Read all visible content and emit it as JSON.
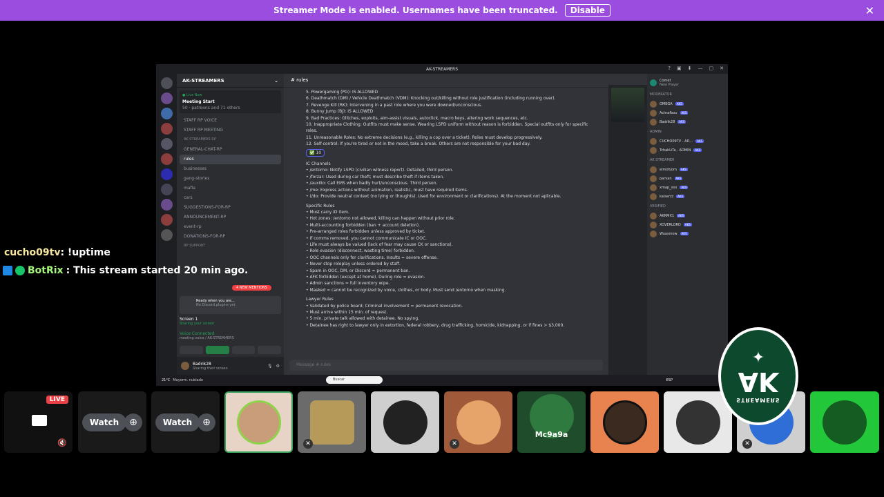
{
  "banner": {
    "text": "Streamer Mode is enabled. Usernames have been truncated.",
    "disable_label": "Disable",
    "close": "✕"
  },
  "window": {
    "title": "AK-STREAMERS",
    "controls": [
      "?",
      "▣",
      "⬇",
      "—",
      "▢",
      "✕"
    ]
  },
  "server": {
    "name": "AK-STREAMERS",
    "event_status": "● Live Now",
    "event_title": "Meeting Start",
    "event_meta": "50 · patreons and 71 others"
  },
  "channels": [
    {
      "label": "STAFF RP VOICE"
    },
    {
      "label": "STAFF RP MEETING"
    },
    {
      "label": "AK STREAMERS RP",
      "cat": true
    },
    {
      "label": "GENERAL-CHAT-RP"
    },
    {
      "label": "rules",
      "selected": true
    },
    {
      "label": "businesses"
    },
    {
      "label": "gang-stories"
    },
    {
      "label": "mafia"
    },
    {
      "label": "cars"
    },
    {
      "label": "SUGGESTIONS-FOR-RP"
    },
    {
      "label": "ANNOUNCEMENT-RP"
    },
    {
      "label": "event-rp"
    },
    {
      "label": "DONATIONS-FOR-RP"
    },
    {
      "label": "RP support",
      "cat": true
    }
  ],
  "mention_badge": "4 NEW MENTIONS",
  "popup": {
    "title": "Ready when you are...",
    "sub": "No Discord plugins yet"
  },
  "screen": {
    "label": "Screen 1",
    "sub": "Sharing your screen"
  },
  "voice": {
    "status": "Voice Connected",
    "channel": "meeting voice / AK-STREAMERS"
  },
  "user": {
    "name": "Badrik28",
    "status": "Sharing their screen"
  },
  "main": {
    "header": "rules",
    "lines": [
      {
        "t": "5. Powergaming (PG): IS ALLOWED"
      },
      {
        "t": "6. Deathmatch (DM) / Vehicle Deathmatch (VDM): Knocking out/killing without role justification (including running over)."
      },
      {
        "t": "7. Revenge Kill (RK): Intervening in a past role where you were downed/unconscious."
      },
      {
        "t": "8. Bunny Jump (BJ): IS ALLOWED"
      },
      {
        "t": "9. Bad Practices: Glitches, exploits, aim-assist visuals, autoclick, macro keys, altering work sequences, etc."
      },
      {
        "t": "10. Inappropriate Clothing: Outfits must make sense. Wearing LSPD uniform without reason is forbidden. Special outfits only for specific roles."
      },
      {
        "t": "11. Unreasonable Roles: No extreme decisions (e.g., killing a cop over a ticket). Roles must develop progressively."
      },
      {
        "t": "12. Self-control: If you're tired or not in the mood, take a break. Others are not responsible for your bad day."
      },
      {
        "t": "IC Channels",
        "h": true
      },
      {
        "t": "• /entorno: Notify LSPD (civilian witness report). Detailed, third person."
      },
      {
        "t": "• /forzar: Used during car theft; must describe theft if items taken."
      },
      {
        "t": "• /auxilio: Call EMS when badly hurt/unconscious. Third person."
      },
      {
        "t": "• /me: Express actions without animation, realistic, must have required items."
      },
      {
        "t": "• (/do: Provide neutral context (no lying or thoughts). Used for environment or clarifications). At the moment not aplicable."
      },
      {
        "t": "Specific Rules",
        "h": true
      },
      {
        "t": "• Must carry ID item."
      },
      {
        "t": "• Hot zones: /entorno not allowed, killing can happen without prior role."
      },
      {
        "t": "• Multi-accounting forbidden (ban + account deletion)."
      },
      {
        "t": "• Pre-arranged roles forbidden unless approved by ticket."
      },
      {
        "t": "• If comms removed, you cannot communicate IC or OOC."
      },
      {
        "t": "• Life must always be valued (lack of fear may cause CK or sanctions)."
      },
      {
        "t": "• Role evasion (disconnect, wasting time) forbidden."
      },
      {
        "t": "• OOC channels only for clarifications. Insults = severe offense."
      },
      {
        "t": "• Never stop roleplay unless ordered by staff."
      },
      {
        "t": "• Spam in OOC, DM, or Discord = permanent ban."
      },
      {
        "t": "• AFK forbidden (except at home). During role = evasion."
      },
      {
        "t": "• Admin sanctions = full inventory wipe."
      },
      {
        "t": "• Masked = cannot be recognized by voice, clothes, or body. Must send /entorno when masking."
      },
      {
        "t": "Lawyer Rules",
        "h": true
      },
      {
        "t": "• Validated by police board. Criminal involvement = permanent revocation."
      },
      {
        "t": "• Must arrive within 15 min. of request."
      },
      {
        "t": "• 5 min. private talk allowed with detainee. No spying."
      },
      {
        "t": "• Detainee has right to lawyer only in extortion, federal robbery, drug trafficking, homicide, kidnapping, or if fines > $3,000."
      }
    ],
    "reaction": "✅ 10",
    "input_placeholder": "Message # rules"
  },
  "members": {
    "top_name": "Comet",
    "top_sub": "New Player",
    "cat1": "MODERATOR",
    "list1": [
      {
        "n": "OMEGA",
        "tag": "AKS"
      },
      {
        "n": "Achrafbou",
        "tag": "AKS"
      },
      {
        "n": "Badrik28",
        "tag": "AKS"
      }
    ],
    "cat2": "ADMIN",
    "list2": [
      {
        "n": "CUCHO09TV - AD...",
        "tag": "AKS"
      },
      {
        "n": "TchakLiTa - ADMIN",
        "tag": "AKS"
      }
    ],
    "cat3": "AK STREAMER",
    "list3": [
      {
        "n": "elmohjom",
        "tag": "AKS"
      },
      {
        "n": "parvan",
        "tag": "AKS"
      },
      {
        "n": "xmap_xxx",
        "tag": "AKS"
      },
      {
        "n": "kaiserzz",
        "tag": "AKS"
      }
    ],
    "cat4": "VERIFIED",
    "list4": [
      {
        "n": "AKRMX1",
        "tag": "AKS"
      },
      {
        "n": "XOVERLORD",
        "tag": "AKS"
      },
      {
        "n": "Wuasmow",
        "tag": "AKS"
      }
    ]
  },
  "taskbar": {
    "weather": "21°C",
    "weather_sub": "Mayorm. nublado",
    "search": "Buscar",
    "lang": "ESP"
  },
  "chat": [
    {
      "user": "cucho09tv",
      "text": ": !uptime"
    },
    {
      "user": "BotRix",
      "text": ": This stream started 20 min ago."
    }
  ],
  "strip": {
    "live": "LIVE",
    "watch1": "Watch",
    "watch2": "Watch",
    "mc": "Mc9a9a"
  },
  "logo": {
    "text": "AK",
    "sub": "STREAMERS"
  }
}
